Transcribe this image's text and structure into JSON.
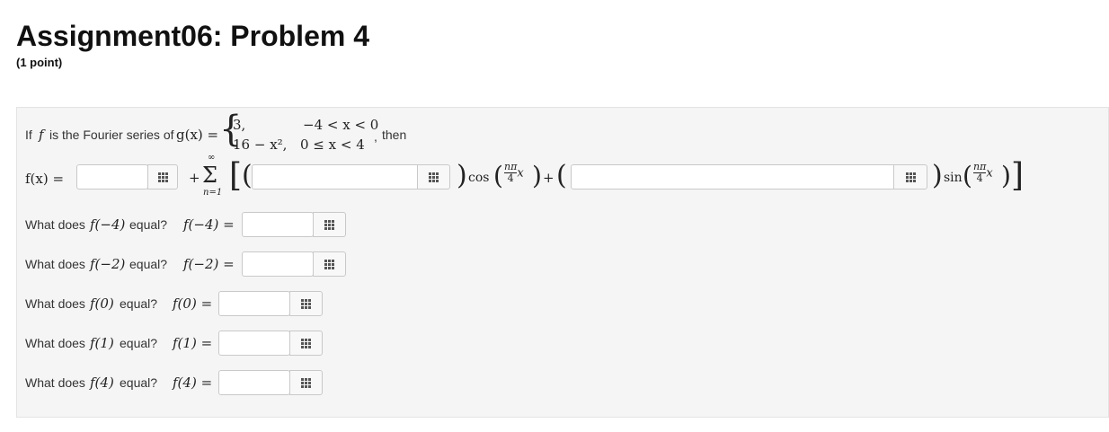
{
  "header": {
    "title": "Assignment06: Problem 4",
    "points": "(1 point)"
  },
  "problem": {
    "intro_if": "If",
    "intro_f": "f",
    "intro_mid": "is the Fourier series of",
    "g_lhs": "g(x) =",
    "case1_value": "3,",
    "case1_cond": "−4 < x < 0",
    "case2_value": "16 − x²,",
    "case2_cond": "0 ≤ x < 4",
    "comma": ",",
    "then": "then",
    "series_lhs": "f(x) =",
    "plus": "+",
    "sum_upper": "∞",
    "sum_symbol": "Σ",
    "sum_lower": "n=1",
    "cos_label": "cos",
    "sin_label": "sin",
    "frac_num": "nπ",
    "frac_den": "4",
    "frac_var": "x",
    "plus2": "+"
  },
  "questions": [
    {
      "prompt_pre": "What does",
      "expr": "f(−4)",
      "prompt_post": "equal?",
      "lhs": "f(−4) ="
    },
    {
      "prompt_pre": "What does",
      "expr": "f(−2)",
      "prompt_post": "equal?",
      "lhs": "f(−2) ="
    },
    {
      "prompt_pre": "What does",
      "expr": "f(0)",
      "prompt_post": "equal?",
      "lhs": "f(0) ="
    },
    {
      "prompt_pre": "What does",
      "expr": "f(1)",
      "prompt_post": "equal?",
      "lhs": "f(1) ="
    },
    {
      "prompt_pre": "What does",
      "expr": "f(4)",
      "prompt_post": "equal?",
      "lhs": "f(4) ="
    }
  ],
  "inputs": {
    "a0": "",
    "an": "",
    "bn": "",
    "q1": "",
    "q2": "",
    "q3": "",
    "q4": "",
    "q5": ""
  },
  "icons": {
    "palette": "equation-palette-icon"
  }
}
